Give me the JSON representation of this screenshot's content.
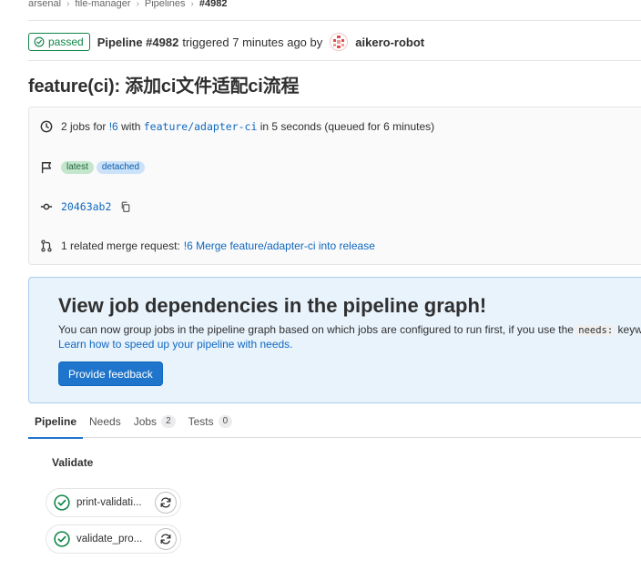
{
  "breadcrumb": {
    "items": [
      "arsenal",
      "file-manager",
      "Pipelines"
    ],
    "current": "#4982"
  },
  "header": {
    "status": "passed",
    "pipeline": "Pipeline #4982",
    "triggered": "triggered 7 minutes ago by",
    "user": "aikero-robot"
  },
  "title": "feature(ci): 添加ci文件适配ci流程",
  "info": {
    "jobs_prefix": "2 jobs for",
    "mr_ref": "!6",
    "with": "with",
    "branch": "feature/adapter-ci",
    "duration": "in 5 seconds (queued for 6 minutes)",
    "tags": [
      "latest",
      "detached"
    ],
    "commit_sha": "20463ab2",
    "related_prefix": "1 related merge request:",
    "related_link": "!6 Merge feature/adapter-ci into release"
  },
  "callout": {
    "heading": "View job dependencies in the pipeline graph!",
    "body_prefix": "You can now group jobs in the pipeline graph based on which jobs are configured to run first, if you use the",
    "body_code": "needs:",
    "body_suffix": "keyword",
    "learn_link": "Learn how to speed up your pipeline with needs.",
    "button": "Provide feedback"
  },
  "tabs": [
    {
      "label": "Pipeline",
      "count": null
    },
    {
      "label": "Needs",
      "count": null
    },
    {
      "label": "Jobs",
      "count": "2"
    },
    {
      "label": "Tests",
      "count": "0"
    }
  ],
  "stage": {
    "title": "Validate",
    "jobs": [
      {
        "label": "print-validati..."
      },
      {
        "label": "validate_pro..."
      }
    ]
  },
  "colors": {
    "success": "#108548",
    "link": "#1068bf",
    "primary": "#1f75cb"
  }
}
